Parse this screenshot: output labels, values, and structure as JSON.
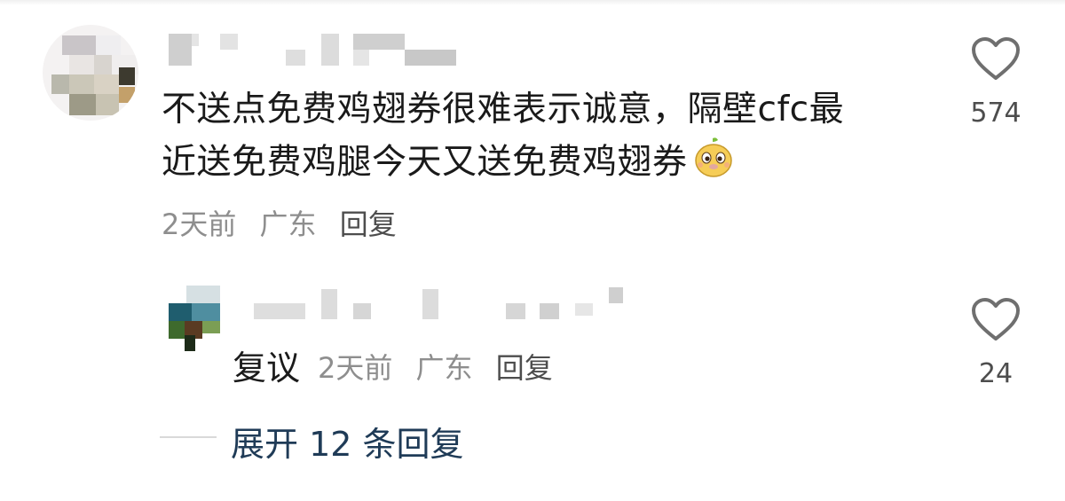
{
  "comments": [
    {
      "text_line1": "不送点免费鸡翅券很难表示诚意，隔壁cfc最",
      "text_line2": "近送免费鸡腿今天又送免费鸡翅券",
      "emoji": "smiling-mascot-emoji",
      "time": "2天前",
      "location": "广东",
      "reply_label": "回复",
      "like_icon": "heart-outline-icon",
      "likes": "574"
    },
    {
      "text": "复议",
      "time": "2天前",
      "location": "广东",
      "reply_label": "回复",
      "like_icon": "heart-outline-icon",
      "likes": "24"
    }
  ],
  "expand_replies": "展开 12 条回复"
}
